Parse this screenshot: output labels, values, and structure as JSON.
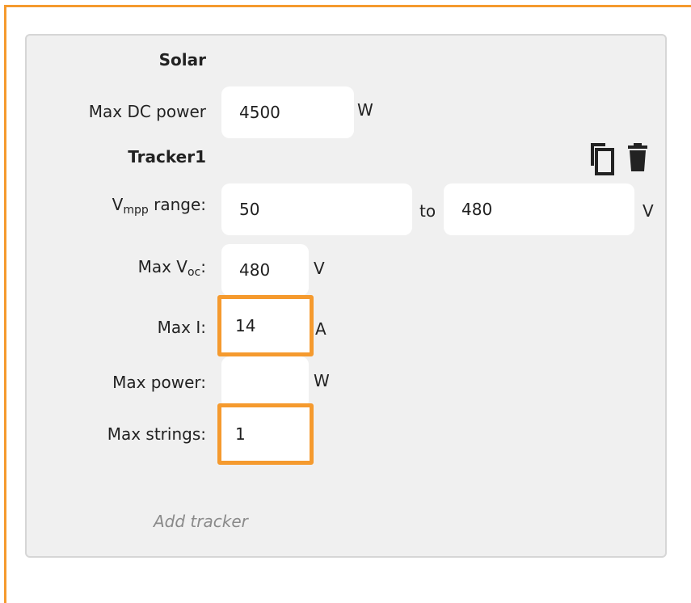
{
  "section": {
    "title": "Solar"
  },
  "max_dc_power": {
    "label": "Max DC power",
    "value": "4500",
    "unit": "W"
  },
  "tracker": {
    "title": "Tracker1",
    "vmpp": {
      "label_base": "V",
      "label_sub": "mpp",
      "label_rest": " range:",
      "from": "50",
      "to_label": "to",
      "to": "480",
      "unit": "V"
    },
    "max_voc": {
      "label_base": "Max V",
      "label_sub": "oc",
      "label_rest": ":",
      "value": "480",
      "unit": "V"
    },
    "max_i": {
      "label": "Max I:",
      "value": "14",
      "unit": "A"
    },
    "max_power": {
      "label": "Max power:",
      "value": "",
      "unit": "W"
    },
    "max_strings": {
      "label": "Max strings:",
      "value": "1"
    }
  },
  "icons": {
    "copy": "copy-icon",
    "delete": "trash-icon"
  },
  "colors": {
    "highlight": "#f59a2e",
    "panel_bg": "#f0f0f0"
  },
  "add_tracker": "Add tracker"
}
